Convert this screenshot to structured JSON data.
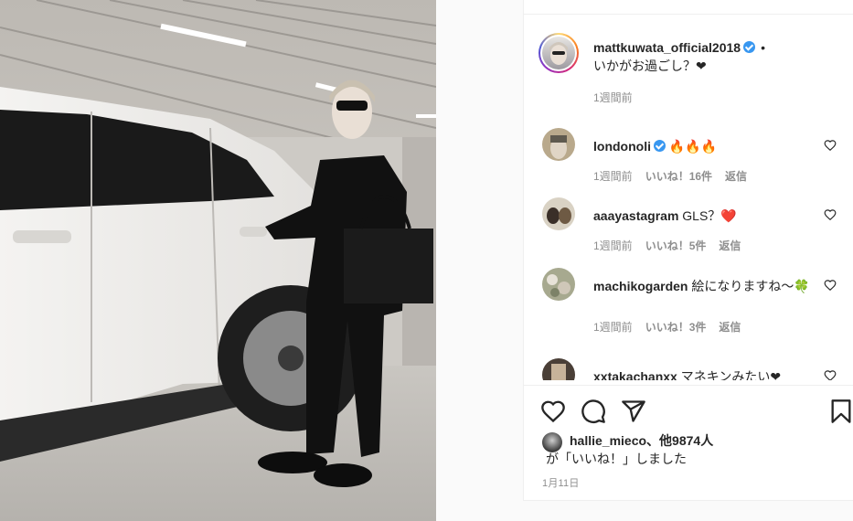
{
  "post": {
    "username": "mattkuwata_official2018",
    "dot": "•",
    "caption": "いかがお過ごし？❤",
    "caption_time": "1週間前"
  },
  "comments": [
    {
      "username": "londonoli",
      "verified": true,
      "text": "🔥🔥🔥",
      "time": "1週間前",
      "likes": "いいね！16件",
      "reply": "返信"
    },
    {
      "username": "aaayastagram",
      "verified": false,
      "text": "GLS？❤️",
      "time": "1週間前",
      "likes": "いいね！5件",
      "reply": "返信"
    },
    {
      "username": "machikogarden",
      "verified": false,
      "text": "絵になりますね〜🍀",
      "time": "1週間前",
      "likes": "いいね！3件",
      "reply": "返信"
    },
    {
      "username": "xxtakachanxx",
      "verified": false,
      "text": "マネキンみたい❤",
      "time": "",
      "likes": "",
      "reply": ""
    }
  ],
  "likes_summary": {
    "user": "hallie_mieco",
    "rest": "、他9874人",
    "line2": "が「いいね！」しました"
  },
  "date": "1月11日",
  "icons": {
    "like": "heart-icon",
    "comment": "comment-icon",
    "share": "share-icon",
    "save": "bookmark-icon"
  },
  "colors": {
    "verified": "#3897f0",
    "secondary_text": "#8e8e8e",
    "border": "#efefef"
  }
}
